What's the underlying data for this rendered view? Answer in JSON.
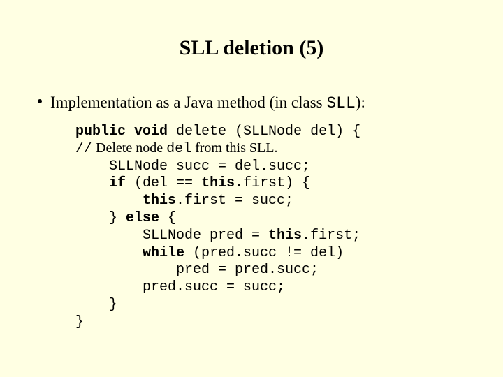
{
  "title": "SLL deletion (5)",
  "bullet": {
    "prefix": "Implementation as a Java method (in class ",
    "class_name": "SLL",
    "suffix": "):"
  },
  "code": {
    "l1_kw": "public void",
    "l1_rest": " delete (SLLNode del) {",
    "l2_slashes": "//",
    "l2_a": " Delete node ",
    "l2_del": "del",
    "l2_b": " from this SLL.",
    "l3": "    SLLNode succ = del.succ;",
    "l4_indent": "    ",
    "l4_if": "if",
    "l4_a": " (del == ",
    "l4_this1": "this",
    "l4_b": ".first) {",
    "l5_indent": "        ",
    "l5_this": "this",
    "l5_rest": ".first = succ;",
    "l6_a": "    } ",
    "l6_else": "else",
    "l6_b": " {",
    "l7_indent": "        SLLNode pred = ",
    "l7_this": "this",
    "l7_rest": ".first;",
    "l8_indent": "        ",
    "l8_while": "while",
    "l8_rest": " (pred.succ != del)",
    "l9": "            pred = pred.succ;",
    "l10": "        pred.succ = succ;",
    "l11": "    }",
    "l12": "}"
  }
}
